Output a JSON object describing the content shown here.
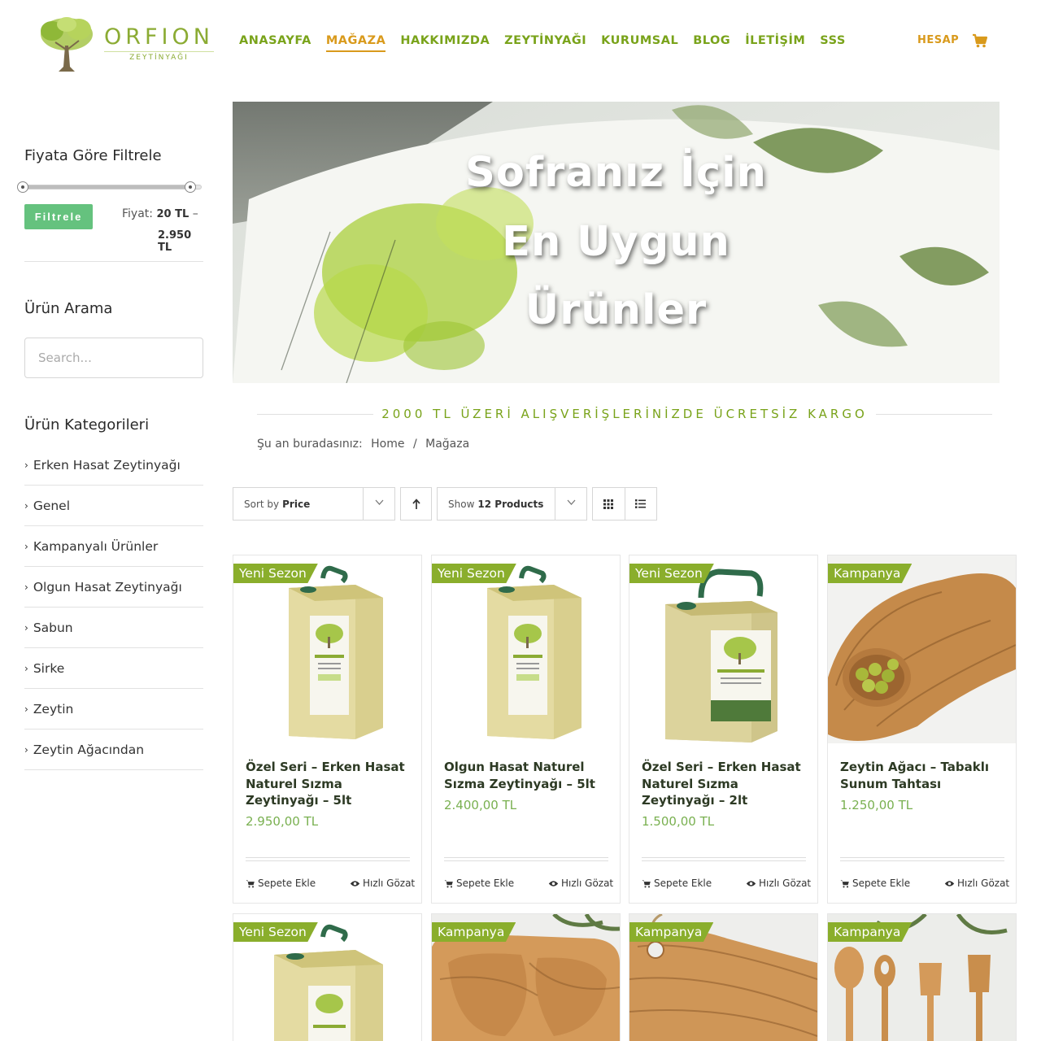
{
  "brand": {
    "name": "ORFION",
    "sub": "ZEYTİNYAĞI",
    "accent": "#79a31a",
    "active_color": "#d99a1c",
    "button_color": "#65c27e"
  },
  "nav": [
    {
      "label": "ANASAYFA",
      "active": false
    },
    {
      "label": "MAĞAZA",
      "active": true
    },
    {
      "label": "HAKKIMIZDA",
      "active": false
    },
    {
      "label": "ZEYTİNYAĞI",
      "active": false
    },
    {
      "label": "KURUMSAL",
      "active": false
    },
    {
      "label": "BLOG",
      "active": false
    },
    {
      "label": "İLETİŞİM",
      "active": false
    },
    {
      "label": "SSS",
      "active": false
    }
  ],
  "header": {
    "account_label": "HESAP",
    "cart_icon": "shopping-cart-icon"
  },
  "sidebar": {
    "price_filter": {
      "title": "Fiyata Göre Filtrele",
      "button": "Filtrele",
      "price_prefix": "Fiyat:",
      "min": "20 TL",
      "dash": "–",
      "max": "2.950 TL"
    },
    "search": {
      "title": "Ürün Arama",
      "placeholder": "Search..."
    },
    "categories": {
      "title": "Ürün Kategorileri",
      "items": [
        "Erken Hasat Zeytinyağı",
        "Genel",
        "Kampanyalı Ürünler",
        "Olgun Hasat Zeytinyağı",
        "Sabun",
        "Sirke",
        "Zeytin",
        "Zeytin Ağacından"
      ]
    }
  },
  "banner": {
    "lines": [
      "Sofranız İçin",
      "En Uygun",
      "Ürünler"
    ]
  },
  "free_shipping": "2000 TL ÜZERİ ALIŞVERİŞLERİNİZDE ÜCRETSİZ KARGO",
  "breadcrumb": {
    "prefix": "Şu an buradasınız:",
    "home": "Home",
    "sep": "/",
    "current": "Mağaza"
  },
  "toolbar": {
    "sort_label": "Sort by",
    "sort_value": "Price",
    "show_label": "Show",
    "show_value": "12 Products"
  },
  "products": [
    {
      "badge": "Yeni Sezon",
      "name": "Özel Seri – Erken Hasat Naturel Sızma Zeytinyağı – 5lt",
      "price": "2.950,00 TL",
      "image": "tin-can-5lt",
      "add_label": "Sepete Ekle",
      "quick_label": "Hızlı Gözat"
    },
    {
      "badge": "Yeni Sezon",
      "name": "Olgun Hasat Naturel Sızma Zeytinyağı – 5lt",
      "price": "2.400,00 TL",
      "image": "tin-can-5lt",
      "add_label": "Sepete Ekle",
      "quick_label": "Hızlı Gözat"
    },
    {
      "badge": "Yeni Sezon",
      "name": "Özel Seri – Erken Hasat Naturel Sızma Zeytinyağı – 2lt",
      "price": "1.500,00 TL",
      "image": "tin-can-2lt",
      "add_label": "Sepete Ekle",
      "quick_label": "Hızlı Gözat"
    },
    {
      "badge": "Kampanya",
      "name": "Zeytin Ağacı – Tabaklı Sunum Tahtası",
      "price": "1.250,00 TL",
      "image": "olive-wood-board",
      "add_label": "Sepete Ekle",
      "quick_label": "Hızlı Gözat"
    }
  ],
  "products_row2": [
    {
      "badge": "Yeni Sezon",
      "image": "tin-can-5lt"
    },
    {
      "badge": "Kampanya",
      "image": "olive-wood-tray"
    },
    {
      "badge": "Kampanya",
      "image": "olive-wood-board"
    },
    {
      "badge": "Kampanya",
      "image": "olive-wood-utensils"
    }
  ]
}
